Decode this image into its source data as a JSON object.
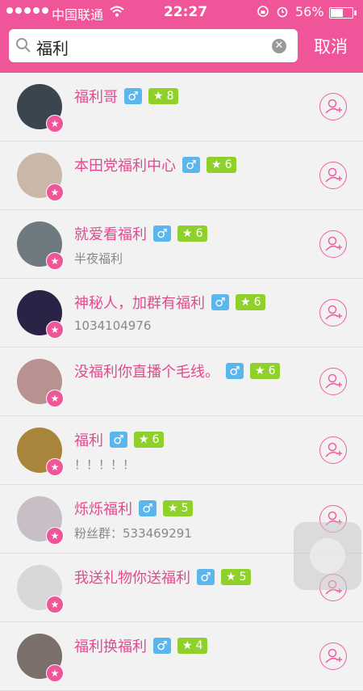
{
  "status": {
    "carrier": "中国联通",
    "time": "22:27",
    "battery": "56%"
  },
  "search": {
    "query": "福利",
    "cancel": "取消"
  },
  "results": [
    {
      "name": "福利哥",
      "gender": "♂",
      "level": "8",
      "sub": "",
      "avatar_color": "#3a4550"
    },
    {
      "name": "本田党福利中心",
      "gender": "♂",
      "level": "6",
      "sub": "",
      "avatar_color": "#c9b7a8"
    },
    {
      "name": "就爱看福利",
      "gender": "♂",
      "level": "6",
      "sub": "半夜福利",
      "avatar_color": "#6f7a80"
    },
    {
      "name": "神秘人，加群有福利",
      "gender": "♂",
      "level": "6",
      "sub": "1034104976",
      "avatar_color": "#2a2346"
    },
    {
      "name": "没福利你直播个毛线。",
      "gender": "♂",
      "level": "6",
      "sub": "",
      "avatar_color": "#b89290"
    },
    {
      "name": "福利",
      "gender": "♂",
      "level": "6",
      "sub": "！！！！！",
      "avatar_color": "#a8853a"
    },
    {
      "name": "烁烁福利",
      "gender": "♂",
      "level": "5",
      "sub": "粉丝群：533469291",
      "avatar_color": "#c7bfc5"
    },
    {
      "name": "我送礼物你送福利",
      "gender": "♂",
      "level": "5",
      "sub": "",
      "avatar_color": "#d8d8d8"
    },
    {
      "name": "福利换福利",
      "gender": "♂",
      "level": "4",
      "sub": "",
      "avatar_color": "#7a6f6a"
    }
  ],
  "colors": {
    "accent": "#f0559a",
    "gender": "#5bb6ee",
    "level": "#8fd12a"
  }
}
